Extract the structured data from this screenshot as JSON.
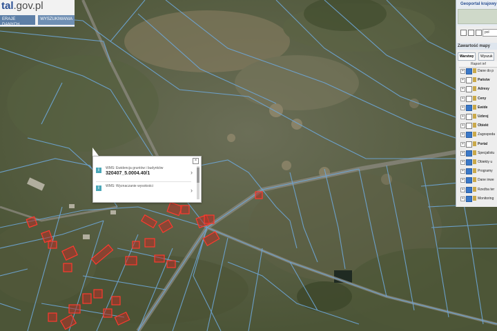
{
  "app": {
    "logo_text": "tal",
    "logo_suffix": ".gov.pl",
    "top_links": [
      "ERAJE DANYCH",
      "WYSZUKIWANIA"
    ]
  },
  "popup": {
    "close_glyph": "×",
    "rows": [
      {
        "title": "WMS: Ewidencja gruntów i budynków",
        "value": "320407_5.0004.40/1"
      },
      {
        "title": "WMS: Wyznaczanie wysokości",
        "value": ""
      }
    ]
  },
  "panel": {
    "title": "Geoportal krajowy",
    "language": "pol",
    "section_title": "Zawartość mapy",
    "tabs": [
      "Warstwy",
      "Wyszuk"
    ],
    "report_button": "Raport inf",
    "layers": [
      {
        "name": "Dane do p",
        "checked": true,
        "bold": false
      },
      {
        "name": "Państw",
        "checked": false,
        "bold": true
      },
      {
        "name": "Adresy",
        "checked": false,
        "bold": true
      },
      {
        "name": "Ceny",
        "checked": false,
        "bold": true
      },
      {
        "name": "Ewide",
        "checked": true,
        "bold": true
      },
      {
        "name": "Uzbroj",
        "checked": false,
        "bold": true
      },
      {
        "name": "Obiekt",
        "checked": false,
        "bold": true
      },
      {
        "name": "Zagospoda",
        "checked": true,
        "bold": false
      },
      {
        "name": "Portal",
        "checked": false,
        "bold": true
      },
      {
        "name": "Specjalistu",
        "checked": true,
        "bold": false
      },
      {
        "name": "Obiekty u",
        "checked": true,
        "bold": false
      },
      {
        "name": "Programy",
        "checked": true,
        "bold": false
      },
      {
        "name": "Dane inwe",
        "checked": true,
        "bold": false
      },
      {
        "name": "Rzeźba ter",
        "checked": true,
        "bold": false
      },
      {
        "name": "Monitoring",
        "checked": true,
        "bold": false
      }
    ]
  },
  "colors": {
    "parcel_line": "#6ea7d8",
    "building_fill": "#b23127",
    "building_stroke": "#ff3a2f"
  }
}
